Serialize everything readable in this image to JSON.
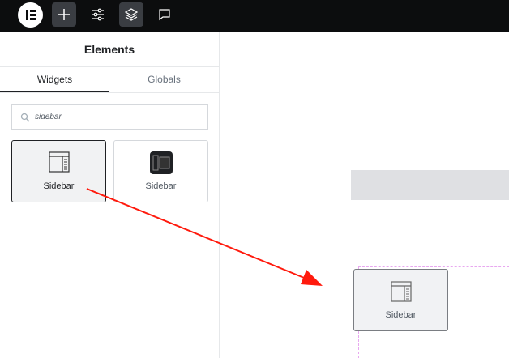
{
  "panel": {
    "title": "Elements",
    "tabs": [
      {
        "label": "Widgets"
      },
      {
        "label": "Globals"
      }
    ],
    "search": {
      "value": "sidebar"
    }
  },
  "widgets": [
    {
      "label": "Sidebar"
    },
    {
      "label": "Sidebar"
    }
  ],
  "dragged": {
    "label": "Sidebar"
  },
  "colors": {
    "arrow": "#ff1a0d",
    "topbar": "#0c0d0e"
  }
}
